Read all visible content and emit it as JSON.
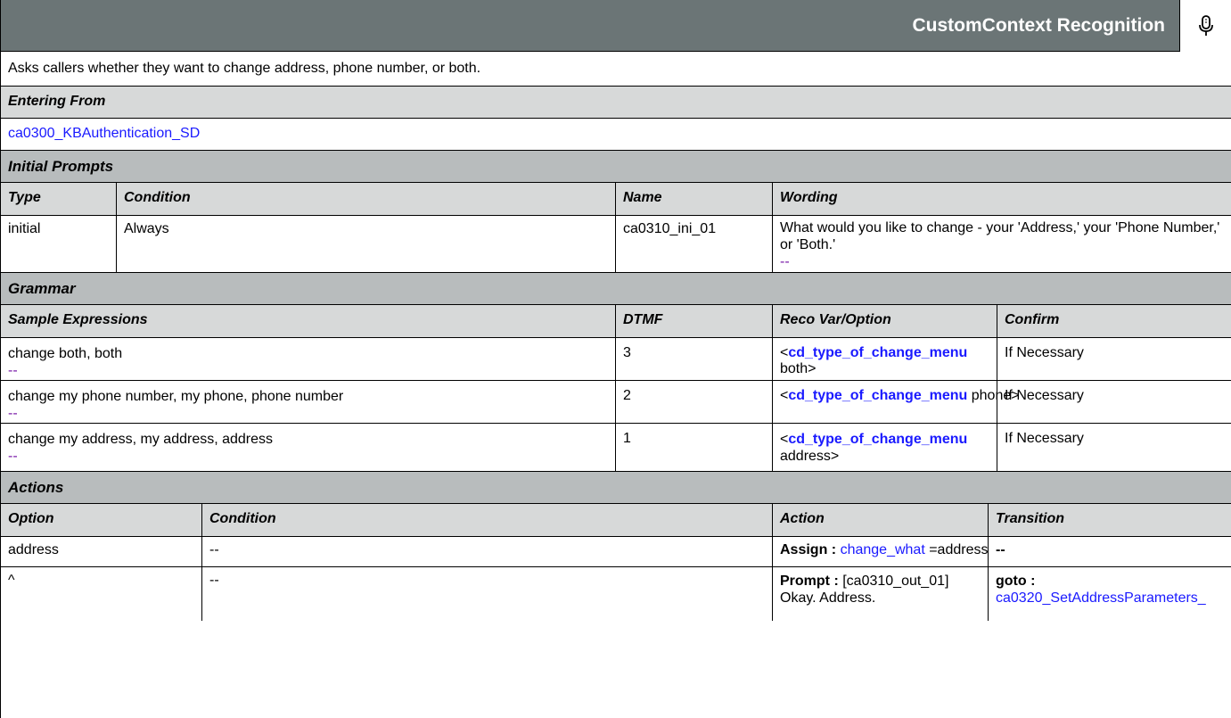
{
  "header": {
    "title": "CustomContext Recognition",
    "icon": "microphone-icon"
  },
  "description": "Asks callers whether they want to change address, phone number, or both.",
  "entering_from": {
    "label": "Entering From",
    "link": "ca0300_KBAuthentication_SD"
  },
  "initial_prompts": {
    "label": "Initial Prompts",
    "columns": [
      "Type",
      "Condition",
      "Name",
      "Wording"
    ],
    "rows": [
      {
        "type": "initial",
        "condition": "Always",
        "name": "ca0310_ini_01",
        "wording": "What would you like to change - your 'Address,' your 'Phone Number,' or 'Both.'",
        "extra": "--"
      }
    ]
  },
  "grammar": {
    "label": "Grammar",
    "columns": [
      "Sample Expressions",
      "DTMF",
      "Reco Var/Option",
      "Confirm"
    ],
    "rows": [
      {
        "expr": "change both, both",
        "extra": "--",
        "dtmf": "3",
        "open": "<",
        "var": "cd_type_of_change_menu",
        "value": " both>",
        "confirm": "If Necessary"
      },
      {
        "expr": "change my phone number, my phone, phone number",
        "extra": "--",
        "dtmf": "2",
        "open": "<",
        "var": "cd_type_of_change_menu",
        "value": " phone>",
        "confirm": "If Necessary"
      },
      {
        "expr": "change my address, my address, address",
        "extra": "--",
        "dtmf": "1",
        "open": "<",
        "var": "cd_type_of_change_menu",
        "value": "address>",
        "confirm": "If Necessary"
      }
    ]
  },
  "actions": {
    "label": "Actions",
    "columns": [
      "Option",
      "Condition",
      "Action",
      "Transition"
    ],
    "rows": [
      {
        "option": "address",
        "condition": "--",
        "action_label": "Assign :",
        "action_link": "change_what",
        "action_rest": " =address",
        "transition_label": "--",
        "transition_link": ""
      },
      {
        "option": "^",
        "condition": "--",
        "action_label": "Prompt :",
        "action_link": "",
        "action_rest": " [ca0310_out_01]",
        "action_line2": "Okay.  Address.",
        "transition_label": "goto :",
        "transition_link": "ca0320_SetAddressParameters_"
      }
    ]
  },
  "colors": {
    "title_bar": "#6b7576",
    "section_bg": "#b8bcbd",
    "header_bg": "#d7d9d9",
    "link": "#1a1aff",
    "placeholder": "#7a1ca8"
  }
}
